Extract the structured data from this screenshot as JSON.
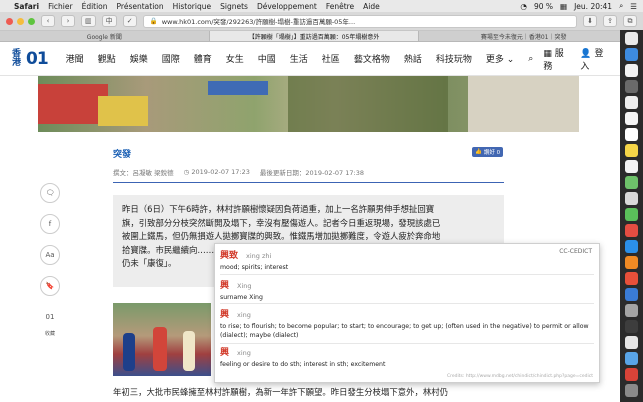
{
  "menubar": {
    "apple": "",
    "items": [
      "Safari",
      "Fichier",
      "Édition",
      "Présentation",
      "Historique",
      "Signets",
      "Développement",
      "Fenêtre",
      "Aide"
    ],
    "battery": "90 %",
    "clock": "Jeu. 20:41"
  },
  "toolbar": {
    "url": "www.hk01.com/突發/292263/許願樹-塌樹-重訪過百萬願-05年...",
    "back": "‹",
    "forward": "›"
  },
  "tabs": [
    {
      "label": "Google 新聞",
      "active": false
    },
    {
      "label": "【許願樹「塌樹」】重訪過百萬願：05年塌樹意外",
      "active": true
    },
    {
      "label": "賽場至今未復元｜香港01｜突發",
      "active": false
    }
  ],
  "site": {
    "logo_hk": "香港",
    "logo_01": "01",
    "nav": [
      "港聞",
      "觀點",
      "娛樂",
      "國際",
      "體育",
      "女生",
      "中國",
      "生活",
      "社區",
      "藝文格物",
      "熱話",
      "科技玩物",
      "更多"
    ],
    "services": "服務",
    "login": "登入"
  },
  "article": {
    "category": "突發",
    "like": "讚好 0",
    "author": "撰文：呂凝敏 梁銳德",
    "published": "2019-02-07 17:23",
    "updated_label": "最後更新日期：2019-02-07 17:38",
    "quote_lines": [
      "昨日（6日）下午6時許，林村許願樹懷疑因負荷過重，加上一名許願男伸手想扯回寶",
      "旗，引致部分分枝突然斷開及塌下，幸沒有壓傷遊人。記者今日重返現場，發現該處已",
      "被圍上鐵馬，但仍無損遊人拋擲寶牒的興致。惟鐵馬增加拋擲難度，令遊人疲於奔命地",
      "拾寶牒。市民繼續向……一代真，許願樹？這……",
      "仍未「康復」。"
    ],
    "body_line": "年初三，大批市民蜂擁至林村許願樹，為新一年許下願望。昨日發生分枝塌下意外，林村仍"
  },
  "share": {
    "comment": "",
    "facebook": "f",
    "font": "Aa",
    "bookmark": "",
    "o1_label": "收藏"
  },
  "dictionary": {
    "source": "CC-CEDICT",
    "entries": [
      {
        "hanzi": "興致",
        "pinyin": "xing zhi",
        "def": "mood; spirits; interest"
      },
      {
        "hanzi": "興",
        "pinyin": "Xing",
        "def": "surname Xing"
      },
      {
        "hanzi": "興",
        "pinyin": "xing",
        "def": "to rise; to flourish; to become popular; to start; to encourage; to get up; (often used in the negative) to permit or allow (dialect); maybe (dialect)"
      },
      {
        "hanzi": "興",
        "pinyin": "xing",
        "def": "feeling or desire to do sth; interest in sth; excitement"
      }
    ],
    "credit": "Credits: http://www.mdbg.net/chindict/chindict.php?page=cedict"
  },
  "colors": {
    "accent": "#1a5fb4",
    "brand": "#0f4c9a",
    "dict_hanzi": "#d23a2a"
  }
}
